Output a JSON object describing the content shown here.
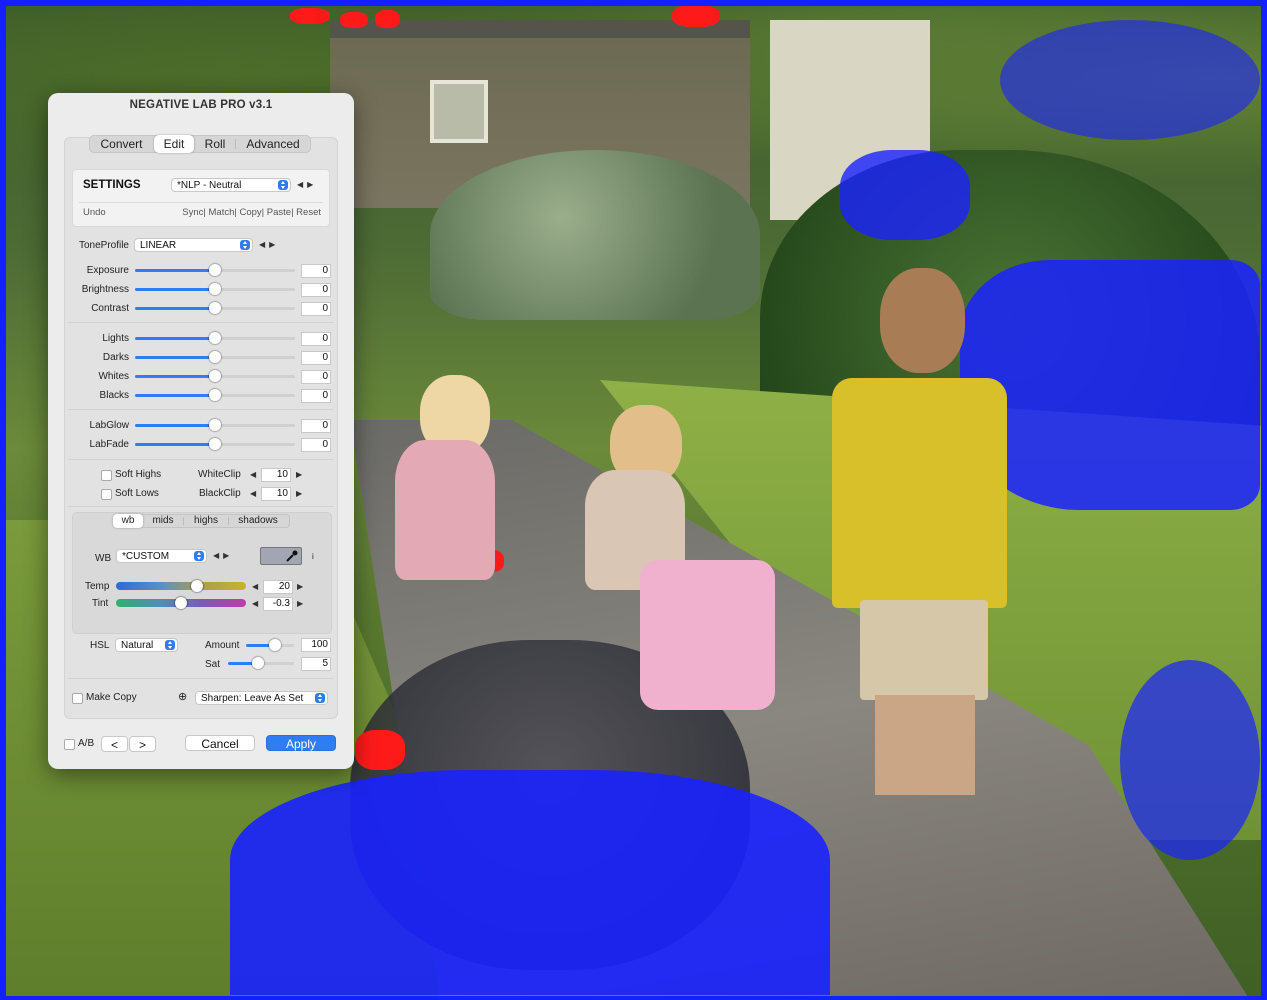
{
  "title": "NEGATIVE LAB PRO v3.1",
  "tabs": [
    "Convert",
    "Edit",
    "Roll",
    "Advanced"
  ],
  "active_tab": "Edit",
  "settings": {
    "label": "SETTINGS",
    "preset": "*NLP - Neutral",
    "undo": "Undo",
    "actions": "Sync| Match| Copy| Paste| Reset"
  },
  "tone": {
    "label": "ToneProfile",
    "value": "LINEAR"
  },
  "sliders": {
    "exposure": {
      "label": "Exposure",
      "value": "0",
      "position": 0.5
    },
    "brightness": {
      "label": "Brightness",
      "value": "0",
      "position": 0.5
    },
    "contrast": {
      "label": "Contrast",
      "value": "0",
      "position": 0.5
    },
    "lights": {
      "label": "Lights",
      "value": "0",
      "position": 0.5
    },
    "darks": {
      "label": "Darks",
      "value": "0",
      "position": 0.5
    },
    "whites": {
      "label": "Whites",
      "value": "0",
      "position": 0.5
    },
    "blacks": {
      "label": "Blacks",
      "value": "0",
      "position": 0.5
    },
    "labglow": {
      "label": "LabGlow",
      "value": "0",
      "position": 0.5
    },
    "labfade": {
      "label": "LabFade",
      "value": "0",
      "position": 0.5
    }
  },
  "clip": {
    "soft_highs": "Soft Highs",
    "soft_lows": "Soft Lows",
    "white_clip_label": "WhiteClip",
    "white_clip_value": "10",
    "black_clip_label": "BlackClip",
    "black_clip_value": "10"
  },
  "subtabs": [
    "wb",
    "mids",
    "highs",
    "shadows"
  ],
  "active_subtab": "wb",
  "wb": {
    "label": "WB",
    "preset": "*CUSTOM",
    "info": "i",
    "temp_label": "Temp",
    "temp_value": "20",
    "temp_position": 0.62,
    "tint_label": "Tint",
    "tint_value": "-0.3",
    "tint_position": 0.5
  },
  "hsl": {
    "label": "HSL",
    "mode": "Natural",
    "amount_label": "Amount",
    "amount_value": "100",
    "amount_position": 0.6,
    "sat_label": "Sat",
    "sat_value": "5",
    "sat_position": 0.45
  },
  "footer": {
    "make_copy": "Make Copy",
    "sharpen": "Sharpen: Leave As Set",
    "ab": "A/B",
    "prev": "<",
    "next": ">",
    "cancel": "Cancel",
    "apply": "Apply"
  },
  "colors": {
    "accent": "#2f7df5",
    "clip_blue": "#1a22ff",
    "clip_red": "#ff1a1a"
  }
}
